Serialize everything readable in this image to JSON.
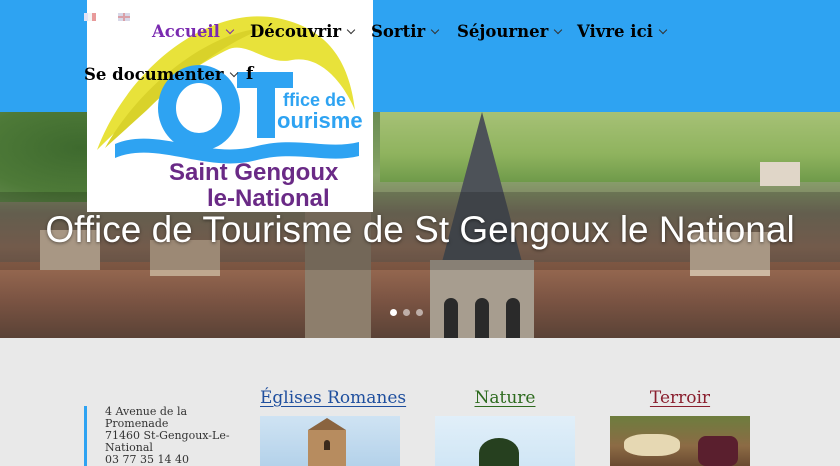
{
  "nav": {
    "items": [
      {
        "label": "Accueil",
        "active": true
      },
      {
        "label": "Découvrir"
      },
      {
        "label": "Sortir"
      },
      {
        "label": "Séjourner"
      },
      {
        "label": "Vivre ici"
      },
      {
        "label": "Se documenter"
      }
    ],
    "languages": [
      "fr-flag-icon",
      "en-flag-icon"
    ],
    "social_icon": "facebook-icon",
    "facebook_glyph": "f"
  },
  "logo": {
    "line1": "ffice de",
    "line2": "ourisme",
    "line3": "Saint Gengoux",
    "line4": "le-National",
    "colors": {
      "blue": "#2ea3f2",
      "yellow": "#e8e23a",
      "purple": "#6a2a86"
    }
  },
  "hero": {
    "title": "Office de Tourisme de St Gengoux le National",
    "slides_count": 3,
    "active_slide": 0
  },
  "contact": {
    "lines": [
      "4 Avenue de la",
      "Promenade",
      "71460 St-Gengoux-Le-",
      "National",
      "03 77 35 14 40"
    ]
  },
  "cards": [
    {
      "title": "Églises Romanes",
      "color": "#1f4f9e"
    },
    {
      "title": "Nature",
      "color": "#2e6b1f"
    },
    {
      "title": "Terroir",
      "color": "#8a1f2e"
    }
  ],
  "colors": {
    "accent": "#2ea3f2",
    "active_nav": "#7a2ab0"
  }
}
